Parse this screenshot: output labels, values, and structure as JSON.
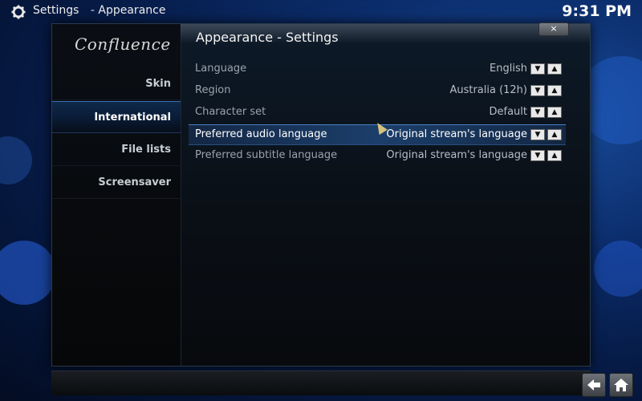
{
  "topbar": {
    "section": "Settings",
    "separator": "-",
    "page": "Appearance",
    "clock": "9:31 PM",
    "icon": "gear-icon"
  },
  "panel": {
    "logo": "Confluence",
    "title": "Appearance - Settings",
    "close_label": "×"
  },
  "sidebar": {
    "items": [
      {
        "label": "Skin",
        "active": false
      },
      {
        "label": "International",
        "active": true
      },
      {
        "label": "File lists",
        "active": false
      },
      {
        "label": "Screensaver",
        "active": false
      }
    ]
  },
  "settings": {
    "rows": [
      {
        "label": "Language",
        "value": "English"
      },
      {
        "label": "Region",
        "value": "Australia (12h)"
      },
      {
        "label": "Character set",
        "value": "Default"
      },
      {
        "label": "Preferred audio language",
        "value": "Original stream's language",
        "focused": true
      },
      {
        "label": "Preferred subtitle language",
        "value": "Original stream's language"
      }
    ],
    "spin_down": "▼",
    "spin_up": "▲"
  },
  "footer": {
    "back_icon": "back-arrow-icon",
    "home_icon": "home-icon"
  },
  "colors": {
    "accent": "#3a70b0",
    "background": "#0b2c6a"
  }
}
